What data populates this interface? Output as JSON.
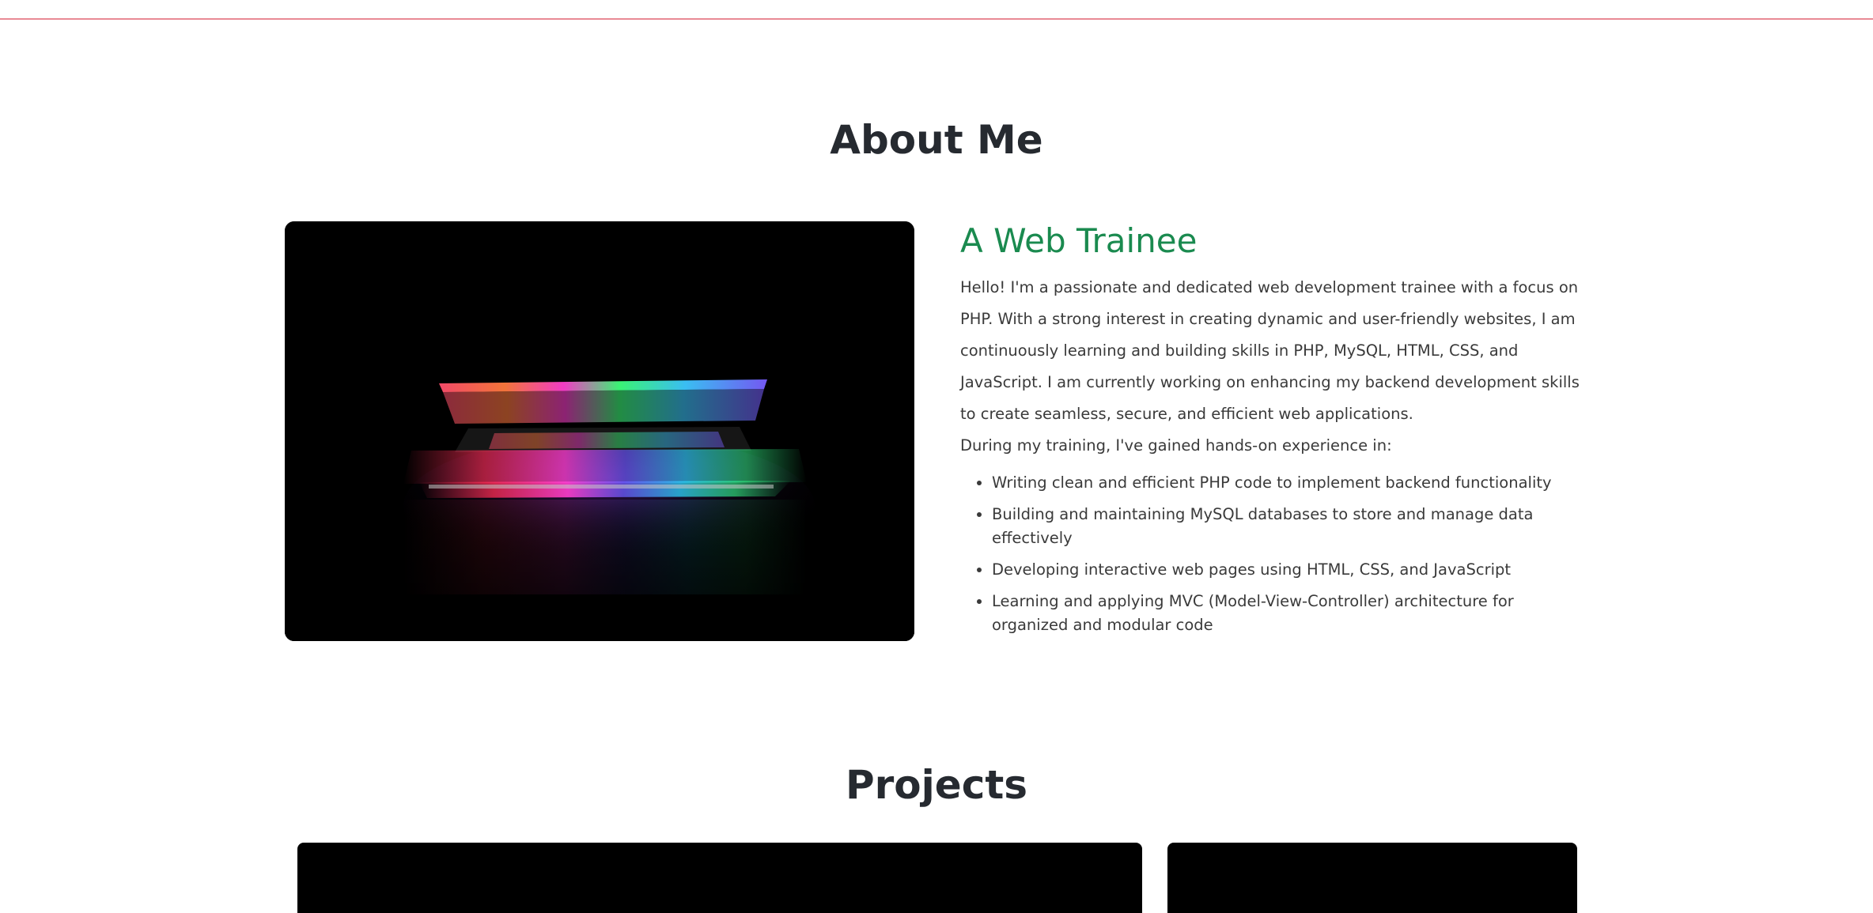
{
  "about": {
    "title": "About Me",
    "subtitle": "A Web Trainee",
    "image_alt": "Laptop with colorful glowing keyboard",
    "bio": "Hello! I'm a passionate and dedicated web development trainee with a focus on PHP. With a strong interest in creating dynamic and user-friendly websites, I am continuously learning and building skills in PHP, MySQL, HTML, CSS, and JavaScript. I am currently working on enhancing my backend development skills to create seamless, secure, and efficient web applications.",
    "intro": "During my training, I've gained hands-on experience in:",
    "skills": [
      "Writing clean and efficient PHP code to implement backend functionality",
      "Building and maintaining MySQL databases to store and manage data effectively",
      "Developing interactive web pages using HTML, CSS, and JavaScript",
      "Learning and applying MVC (Model-View-Controller) architecture for organized and modular code"
    ]
  },
  "projects": {
    "title": "Projects"
  },
  "colors": {
    "accent": "#1a8a4f",
    "heading": "#262a30",
    "top_rule": "#e98a95"
  }
}
